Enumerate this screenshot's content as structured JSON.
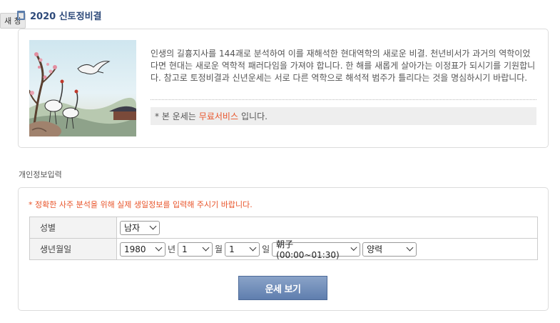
{
  "new_window_label": "새 창",
  "page_title": "2020 신토정비결",
  "intro": {
    "description": "인생의 길흉지사를 144괘로 분석하여 이를 재해석한 현대역학의 새로운 비결. 천년비서가 과거의 역학이었다면 현대는 새로운 역학적 패러다임을 가져야 합니다. 한 해를 새롭게 살아가는 이정표가 되시기를 기원합니다. 참고로 토정비결과 신년운세는 서로 다른 역학으로 해석적 범주가 틀리다는 것을 명심하시기 바랍니다.",
    "notice_prefix": "* 본 운세는",
    "notice_highlight": "무료서비스",
    "notice_suffix": "입니다."
  },
  "form_section": {
    "title": "개인정보입력",
    "warning": "* 정확한 사주 분석을 위해 실제 생일정보를 입력해 주시기 바랍니다.",
    "gender_label": "성별",
    "gender_value": "남자",
    "birth_label": "생년월일",
    "year_value": "1980",
    "year_unit": "년",
    "month_value": "1",
    "month_unit": "월",
    "day_value": "1",
    "day_unit": "일",
    "hour_value": "朝子(00:00~01:30)",
    "calendar_value": "양력",
    "submit_label": "운세 보기"
  },
  "colors": {
    "accent": "#e8542a",
    "title": "#2e4a7a",
    "button": "#6f8cb9"
  }
}
